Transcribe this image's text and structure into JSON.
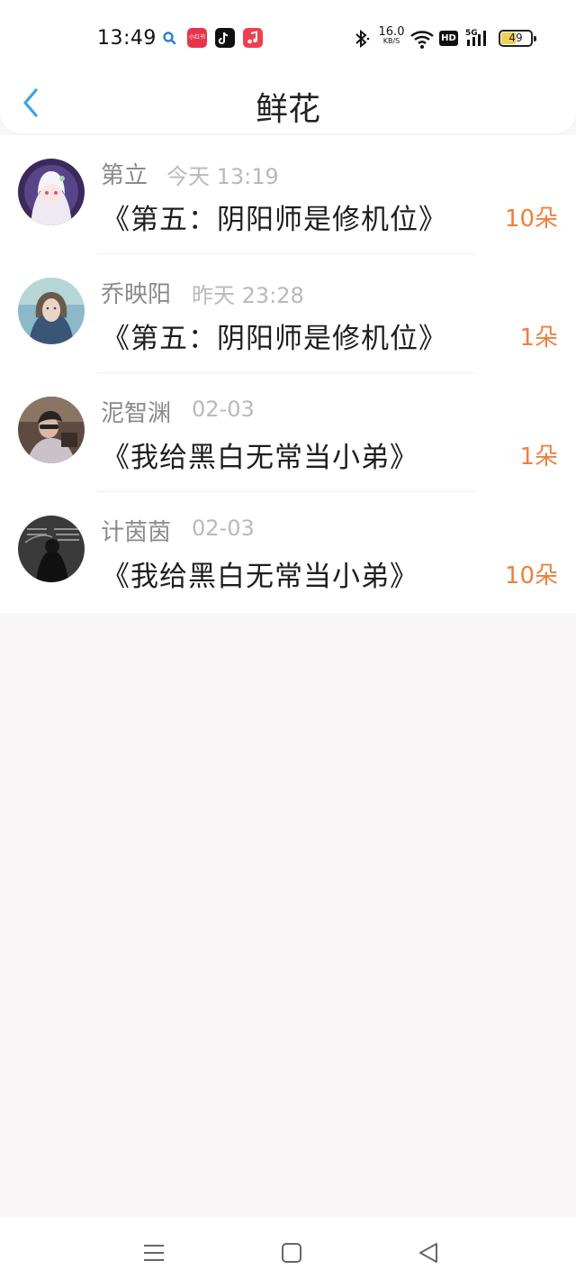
{
  "status_bar": {
    "time": "13:49",
    "app_icon_label": "小红书",
    "net_speed": "16.0",
    "net_speed_unit": "KB/S",
    "hd_label": "HD",
    "network": "5G",
    "battery": "49"
  },
  "header": {
    "title": "鲜花"
  },
  "items": [
    {
      "name": "第立",
      "time": "今天 13:19",
      "book": "《第五：阴阳师是修机位》",
      "count": "10朵"
    },
    {
      "name": "乔映阳",
      "time": "昨天 23:28",
      "book": "《第五：阴阳师是修机位》",
      "count": "1朵"
    },
    {
      "name": "泥智渊",
      "time": "02-03",
      "book": "《我给黑白无常当小弟》",
      "count": "1朵"
    },
    {
      "name": "计茵茵",
      "time": "02-03",
      "book": "《我给黑白无常当小弟》",
      "count": "10朵"
    }
  ],
  "colors": {
    "accent_blue": "#3aa3e8",
    "flower_count": "#f07f3c",
    "name_gray": "#8a8a8a",
    "time_gray": "#b9b9b9",
    "background": "#f8f6f7"
  },
  "icons": {
    "back": "chevron-left-icon",
    "nav_menu": "menu-icon",
    "nav_home": "square-icon",
    "nav_back": "triangle-back-icon"
  }
}
